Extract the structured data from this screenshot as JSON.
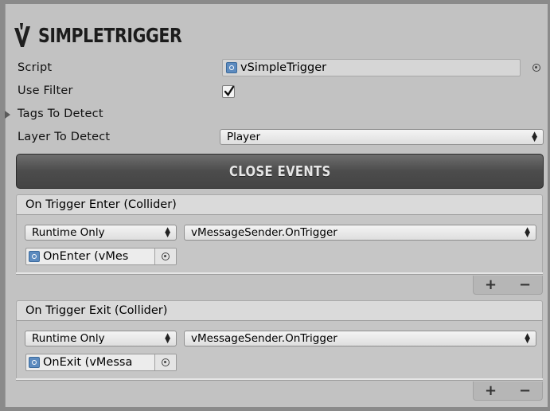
{
  "header": {
    "title": "SimpleTrigger"
  },
  "fields": {
    "script_label": "Script",
    "script_value": "vSimpleTrigger",
    "use_filter_label": "Use Filter",
    "use_filter_checked": true,
    "tags_label": "Tags To Detect",
    "layer_label": "Layer To Detect",
    "layer_value": "Player"
  },
  "close_events_label": "Close Events",
  "events": [
    {
      "title": "On Trigger Enter (Collider)",
      "mode": "Runtime Only",
      "function": "vMessageSender.OnTrigger",
      "target": "OnEnter (vMes"
    },
    {
      "title": "On Trigger Exit (Collider)",
      "mode": "Runtime Only",
      "function": "vMessageSender.OnTrigger",
      "target": "OnExit (vMessa"
    }
  ],
  "list_controls": {
    "add": "+",
    "remove": "−"
  },
  "colors": {
    "panel_bg": "#c2c2c2",
    "button_dark": "#4c4c4c",
    "object_icon": "#5d8bbf"
  }
}
